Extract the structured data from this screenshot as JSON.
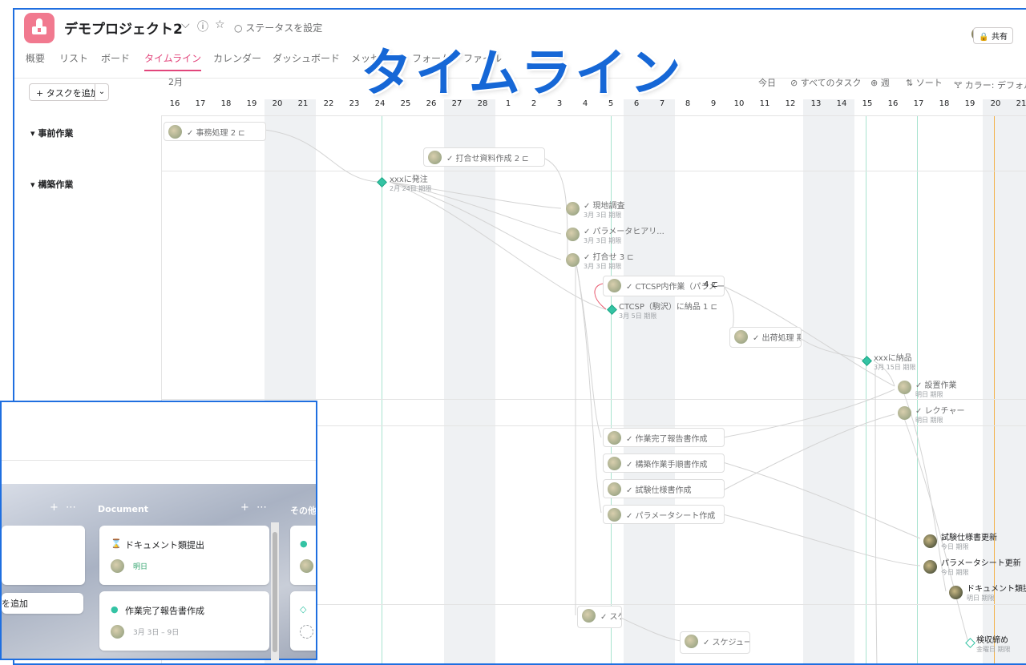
{
  "header": {
    "project_title": "デモプロジェクト2",
    "caret": "⌵",
    "info_icon": "ⓘ",
    "star_icon": "☆",
    "status": "○ ステータスを設定",
    "share": "🔒 共有"
  },
  "tabs": [
    {
      "label": "概要"
    },
    {
      "label": "リスト"
    },
    {
      "label": "ボード"
    },
    {
      "label": "タイムライン",
      "active": true
    },
    {
      "label": "カレンダー"
    },
    {
      "label": "ダッシュボード"
    },
    {
      "label": "メッセージ"
    },
    {
      "label": "フォーム"
    },
    {
      "label": "ファイル"
    }
  ],
  "overlay_title": "タイムライン",
  "toolbar": {
    "add_task": "+ タスクを追加",
    "add_caret": "⌄",
    "today": "今日",
    "all_tasks": "⊘ すべてのタスク",
    "zoom": "⊕ 週",
    "sort": "⇅ ソート",
    "color": "🝖 カラー: デフォルト"
  },
  "timeline": {
    "month": "2月",
    "days": [
      "16",
      "17",
      "18",
      "19",
      "20",
      "21",
      "22",
      "23",
      "24",
      "25",
      "26",
      "27",
      "28",
      "1",
      "2",
      "3",
      "4",
      "5",
      "6",
      "7",
      "8",
      "9",
      "10",
      "11",
      "12",
      "13",
      "14",
      "15",
      "16",
      "17",
      "18",
      "19",
      "20",
      "21"
    ],
    "sections": [
      {
        "name": "事前作業"
      },
      {
        "name": "構築作業"
      }
    ],
    "tasks": {
      "t1": "✓ 事務処理 2 ⊏",
      "t2": "✓ 打合せ資料作成 2 ⊏",
      "t3": "✓ CTCSP内作業（パラメータ設定...",
      "t3b": "4 ⊏",
      "t4": "✓ 出荷処理 期間",
      "t5": "✓ 作業完了報告書作成",
      "t6": "✓ 構築作業手順書作成",
      "t7": "✓ 試験仕様書作成",
      "t8": "✓ パラメータシート作成",
      "t9": "✓ スケ",
      "t10": "✓ スケジュール（..."
    },
    "labels": {
      "m1": "xxxに発注",
      "m1d": "2月 24日 期限",
      "a1": "✓ 現地調査",
      "a1d": "3月 3日 期限",
      "a2": "✓ パラメータヒアリ...",
      "a2d": "3月 3日 期限",
      "a3": "✓ 打合せ 3 ⊏",
      "a3d": "3月 3日 期限",
      "m2": "CTCSP（駒沢）に納品 1 ⊏",
      "m2d": "3月 5日 期限",
      "m3": "xxxに納品",
      "m3d": "3月 15日 期限",
      "b1": "✓ 設置作業",
      "b1d": "明日 期限",
      "b2": "✓ レクチャー",
      "b2d": "明日 期限",
      "c1": "試験仕様書更新",
      "c1d": "今日 期限",
      "c2": "パラメータシート更新",
      "c2d": "今日 期限",
      "c3": "ドキュメント類提出",
      "c3d": "明日 期限",
      "m4": "検収締め",
      "m4d": "金曜日 期限"
    }
  },
  "board": {
    "col_doc": "Document",
    "col_other": "その他",
    "plus": "+",
    "more": "⋯",
    "add_task": "を追加",
    "card1_title": "ドキュメント類提出",
    "card1_due": "明日",
    "card2_title": "作業完了報告書作成",
    "card2_due": "3月 3日 – 9日"
  }
}
